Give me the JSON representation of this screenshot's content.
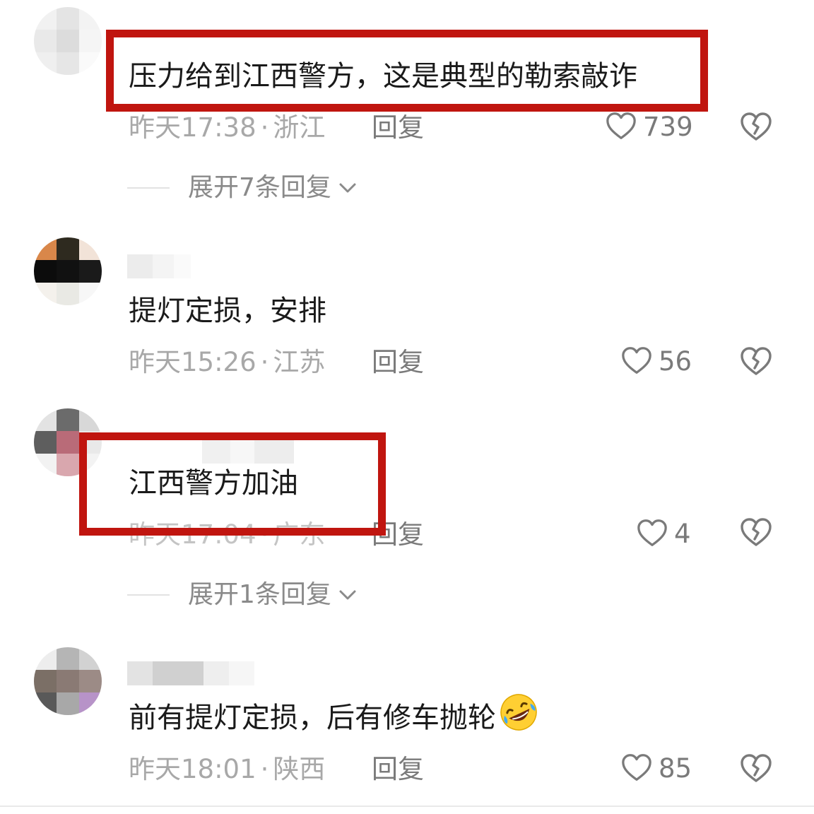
{
  "colors": {
    "highlight": "#c0150f",
    "meta_text": "#a8a8a8",
    "body_text": "#1a1a1a"
  },
  "icons": {
    "like": "heart-outline",
    "dislike": "broken-heart-outline",
    "expand": "chevron-down",
    "emoji": "rolling-on-floor-laughing"
  },
  "comments": [
    {
      "text": "压力给到江西警方，这是典型的勒索敲诈",
      "time": "昨天17:38",
      "location": "浙江",
      "reply_label": "回复",
      "likes": "739",
      "expand_label": "展开7条回复",
      "highlighted": true
    },
    {
      "text": "提灯定损，安排",
      "time": "昨天15:26",
      "location": "江苏",
      "reply_label": "回复",
      "likes": "56",
      "highlighted": false
    },
    {
      "text": "江西警方加油",
      "time": "昨天17:04",
      "location": "广东",
      "reply_label": "回复",
      "likes": "4",
      "expand_label": "展开1条回复",
      "highlighted": true
    },
    {
      "text": "前有提灯定损，后有修车抛轮",
      "time": "昨天18:01",
      "location": "陕西",
      "reply_label": "回复",
      "likes": "85",
      "highlighted": false
    }
  ]
}
